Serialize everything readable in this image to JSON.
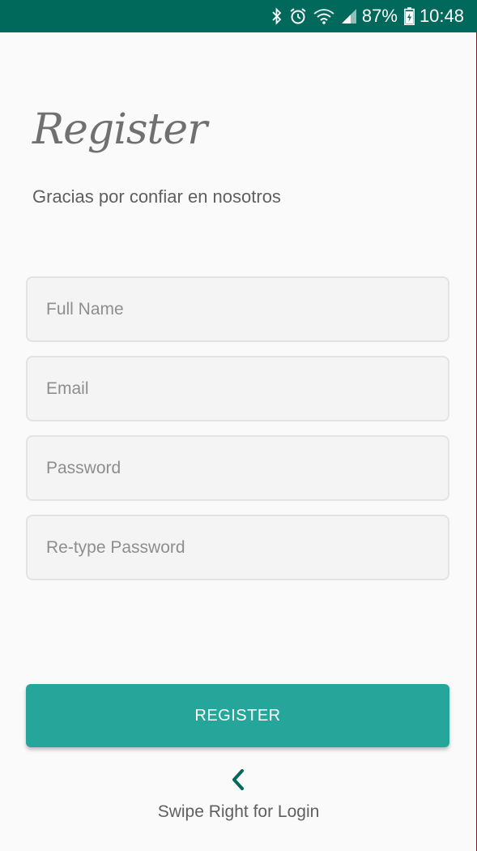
{
  "status_bar": {
    "battery_percent": "87%",
    "time": "10:48",
    "icons": [
      "bluetooth-icon",
      "alarm-icon",
      "wifi-icon",
      "cell-signal-icon",
      "battery-icon"
    ],
    "background_color": "#00695c"
  },
  "header": {
    "title": "Register",
    "subtitle": "Gracias por confiar en nosotros"
  },
  "form": {
    "full_name": {
      "value": "",
      "placeholder": "Full Name"
    },
    "email": {
      "value": "",
      "placeholder": "Email"
    },
    "password": {
      "value": "",
      "placeholder": "Password"
    },
    "retype_password": {
      "value": "",
      "placeholder": "Re-type Password"
    }
  },
  "actions": {
    "register_label": "REGISTER",
    "register_color": "#26a69a",
    "swipe_hint": "Swipe Right for Login",
    "swipe_icon": "chevron-left-icon",
    "chevron_color": "#00695c"
  }
}
